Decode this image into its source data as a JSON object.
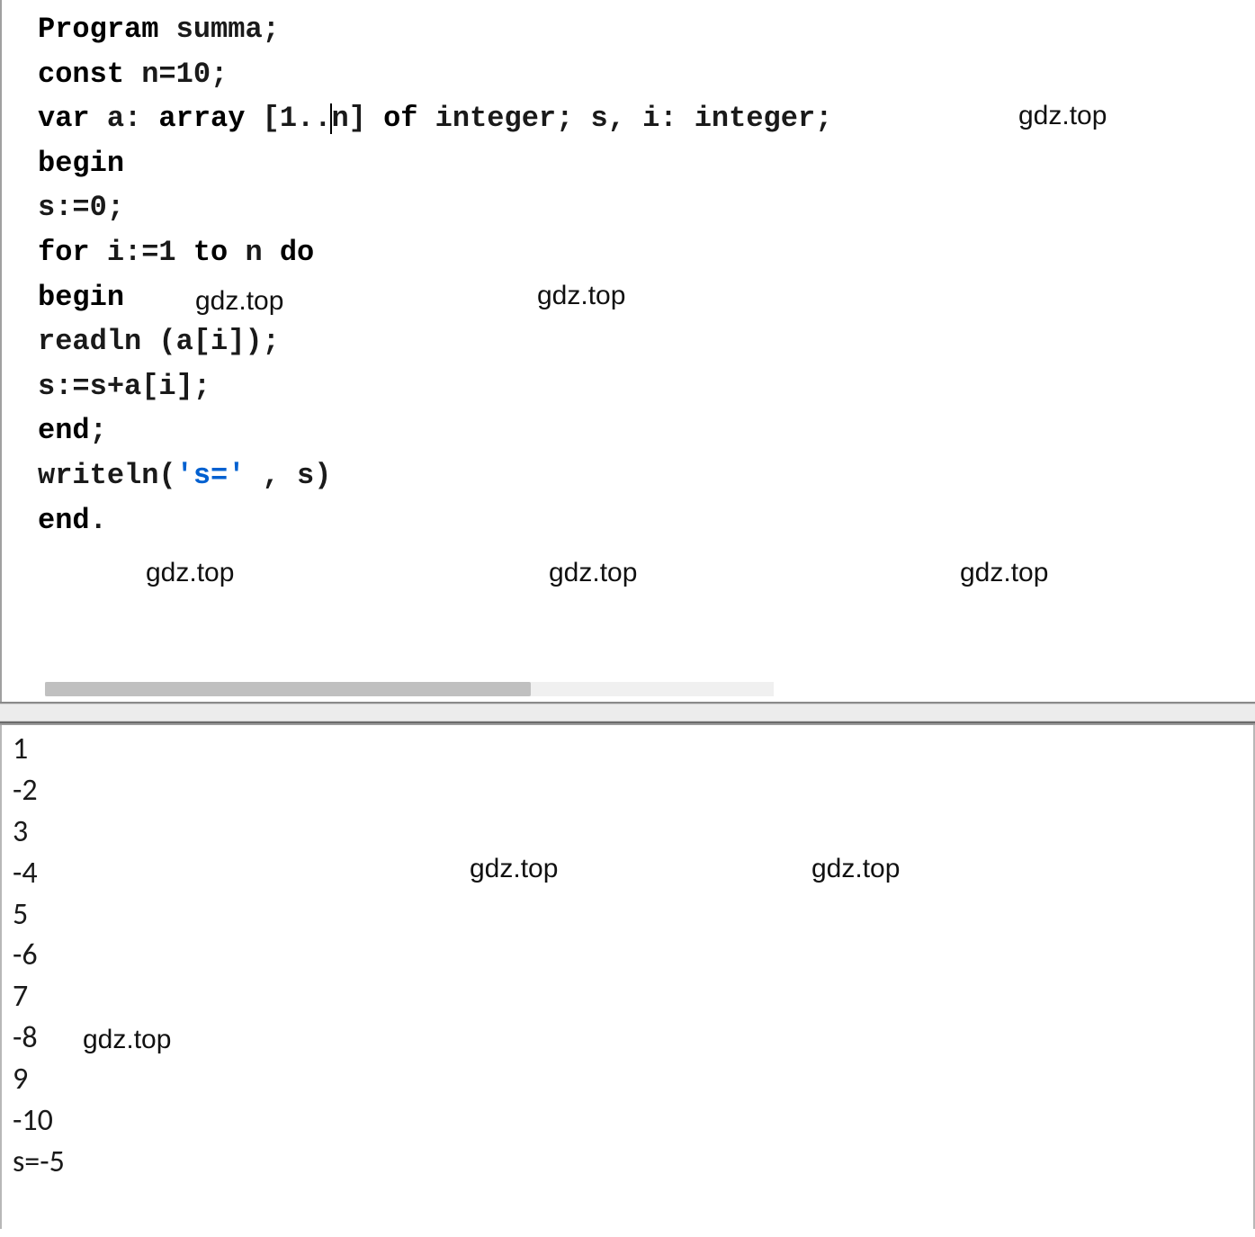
{
  "code": {
    "l1_a": "Program",
    "l1_b": " summa;",
    "l2_a": "const",
    "l2_b": " n=10;",
    "l3_a": "var",
    "l3_b": " a: ",
    "l3_c": "array",
    "l3_d": " [1..",
    "l3_e": "n] ",
    "l3_f": "of",
    "l3_g": " integer; s, i: integer;",
    "l4": "begin",
    "l5": "s:=0;",
    "l6_a": "for",
    "l6_b": " i:=1 ",
    "l6_c": "to",
    "l6_d": " n ",
    "l6_e": "do",
    "l7": "begin",
    "l8": "readln (a[i]);",
    "l9": "s:=s+a[i];",
    "l10_a": "end",
    "l10_b": ";",
    "l11_a": "writeln(",
    "l11_b": "'s='",
    "l11_c": " , s)",
    "l12_a": "end",
    "l12_b": "."
  },
  "watermarks": {
    "w1": "gdz.top",
    "w2": "gdz.top",
    "w3": "gdz.top",
    "w4": "gdz.top",
    "w5": "gdz.top",
    "w6": "gdz.top",
    "w7": "gdz.top",
    "w8": "gdz.top",
    "w9": "gdz.top"
  },
  "output": {
    "lines": [
      "1",
      "-2",
      "3",
      "-4",
      "5",
      "-6",
      "7",
      "-8",
      "9",
      "-10",
      "s=-5"
    ]
  }
}
